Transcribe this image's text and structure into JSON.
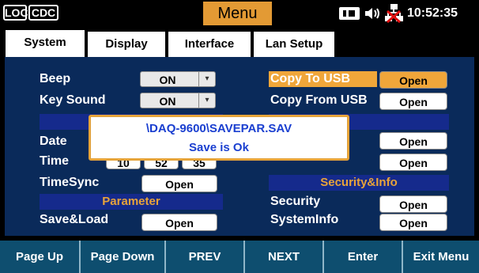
{
  "header": {
    "loc_tag": "LOC",
    "cdc_tag": "CDC",
    "title": "Menu",
    "clock": "10:52:35",
    "icons": [
      "storage-icon",
      "speaker-icon",
      "network-disconnected-icon"
    ],
    "colors": {
      "title_bg": "#e39a34",
      "accent": "#f0a63a",
      "panel": "#0a2a5a",
      "section_bar": "#152a8c"
    }
  },
  "tabs": [
    {
      "label": "System",
      "selected": true
    },
    {
      "label": "Display",
      "selected": false
    },
    {
      "label": "Interface",
      "selected": false
    },
    {
      "label": "Lan Setup",
      "selected": false
    }
  ],
  "left": {
    "beep": {
      "label": "Beep",
      "value": "ON"
    },
    "key_sound": {
      "label": "Key Sound",
      "value": "ON"
    },
    "date_label": "Date",
    "time_label": "Time",
    "time_parts": [
      "10",
      "52",
      "35"
    ],
    "timesync": {
      "label": "TimeSync",
      "button": "Open"
    },
    "parameter_header": "Parameter",
    "save_load": {
      "label": "Save&Load",
      "button": "Open"
    }
  },
  "right": {
    "copy_to_usb": {
      "label": "Copy To USB",
      "button": "Open"
    },
    "copy_from_usb": {
      "label": "Copy From USB",
      "button": "Open"
    },
    "row3_button": "Open",
    "row4_button": "Open",
    "security_header": "Security&Info",
    "security": {
      "label": "Security",
      "button": "Open"
    },
    "systeminfo": {
      "label": "SystemInfo",
      "button": "Open"
    }
  },
  "popup": {
    "line1": "\\DAQ-9600\\SAVEPAR.SAV",
    "line2": "Save is Ok"
  },
  "softkeys": [
    "Page Up",
    "Page Down",
    "PREV",
    "NEXT",
    "Enter",
    "Exit Menu"
  ]
}
